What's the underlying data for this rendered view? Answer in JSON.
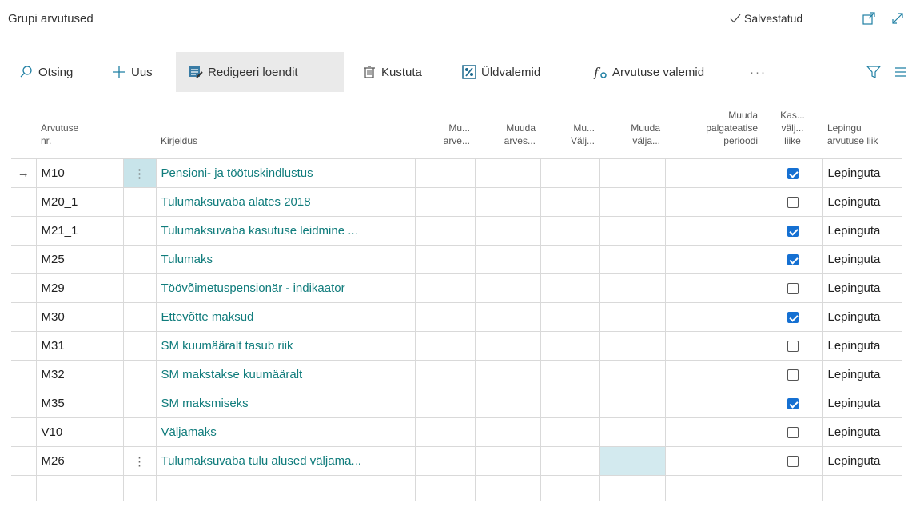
{
  "header": {
    "title": "Grupi arvutused",
    "status": "Salvestatud"
  },
  "toolbar": {
    "search": "Otsing",
    "new": "Uus",
    "edit_list": "Redigeeri loendit",
    "delete": "Kustuta",
    "general_formulas": "Üldvalemid",
    "calc_formulas": "Arvutuse valemid"
  },
  "columns": {
    "nr_line1": "Arvutuse",
    "nr_line2": "nr.",
    "desc": "Kirjeldus",
    "c1_line1": "Mu...",
    "c1_line2": "arve...",
    "c2_line1": "Muuda",
    "c2_line2": "arves...",
    "c3_line1": "Mu...",
    "c3_line2": "Välj...",
    "c4_line1": "Muuda",
    "c4_line2": "välja...",
    "c5_line1": "Muuda",
    "c5_line2": "palgateatise",
    "c5_line3": "perioodi",
    "c6_line1": "Kas...",
    "c6_line2": "välj...",
    "c6_line3": "liike",
    "c7_line1": "Lepingu",
    "c7_line2": "arvutuse liik"
  },
  "rows": [
    {
      "nr": "M10",
      "desc": "Pensioni- ja töötuskindlustus",
      "checked": true,
      "contract": "Lepinguta"
    },
    {
      "nr": "M20_1",
      "desc": "Tulumaksuvaba alates 2018",
      "checked": false,
      "contract": "Lepinguta"
    },
    {
      "nr": "M21_1",
      "desc": "Tulumaksuvaba kasutuse leidmine ...",
      "checked": true,
      "contract": "Lepinguta"
    },
    {
      "nr": "M25",
      "desc": "Tulumaks",
      "checked": true,
      "contract": "Lepinguta"
    },
    {
      "nr": "M29",
      "desc": "Töövõimetuspensionär - indikaator",
      "checked": false,
      "contract": "Lepinguta"
    },
    {
      "nr": "M30",
      "desc": "Ettevõtte maksud",
      "checked": true,
      "contract": "Lepinguta"
    },
    {
      "nr": "M31",
      "desc": "SM kuumääralt tasub riik",
      "checked": false,
      "contract": "Lepinguta"
    },
    {
      "nr": "M32",
      "desc": "SM makstakse kuumääralt",
      "checked": false,
      "contract": "Lepinguta"
    },
    {
      "nr": "M35",
      "desc": "SM maksmiseks",
      "checked": true,
      "contract": "Lepinguta"
    },
    {
      "nr": "V10",
      "desc": "Väljamaks",
      "checked": false,
      "contract": "Lepinguta"
    },
    {
      "nr": "M26",
      "desc": "Tulumaksuvaba tulu alused väljama...",
      "checked": false,
      "contract": "Lepinguta"
    }
  ],
  "colors": {
    "link": "#107c7c",
    "checkbox_accent": "#1570d2",
    "selected_cell": "#c8e4ea"
  }
}
